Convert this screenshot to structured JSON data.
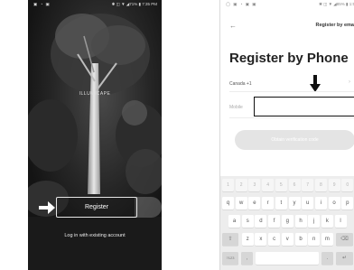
{
  "phone1": {
    "status_left": "▣ ◔ ▣",
    "status_right": "✱ ◫ ▼ ◢71% ▮ 7:35 PM",
    "brand": "ILLUMICAPE",
    "register_label": "Register",
    "login_label": "Log in with existing account",
    "arrow_color": "#ffffff"
  },
  "phone2": {
    "status_left": "◯ ▣ ◔ ▣ ▣",
    "status_right": "✱ ◫ ▼ ◢85% ▮ 1:5",
    "back_icon": "←",
    "email_link": "Register by ema",
    "title": "Register by Phone",
    "country": "Canada +1",
    "country_chevron": "›",
    "mobile_label": "Mobile",
    "mobile_value": "",
    "obtain_label": "Obtain verification code",
    "arrow_color": "#111111"
  },
  "keyboard": {
    "numbers": [
      "1",
      "2",
      "3",
      "4",
      "5",
      "6",
      "7",
      "8",
      "9",
      "0"
    ],
    "row1": [
      "q",
      "w",
      "e",
      "r",
      "t",
      "y",
      "u",
      "i",
      "o",
      "p"
    ],
    "row2": [
      "a",
      "s",
      "d",
      "f",
      "g",
      "h",
      "j",
      "k",
      "l"
    ],
    "row3": [
      "z",
      "x",
      "c",
      "v",
      "b",
      "n",
      "m"
    ],
    "shift": "⇧",
    "backspace": "⌫",
    "sym": "?123",
    "comma": ",",
    "space": "",
    "period": ".",
    "enter": "↵"
  }
}
